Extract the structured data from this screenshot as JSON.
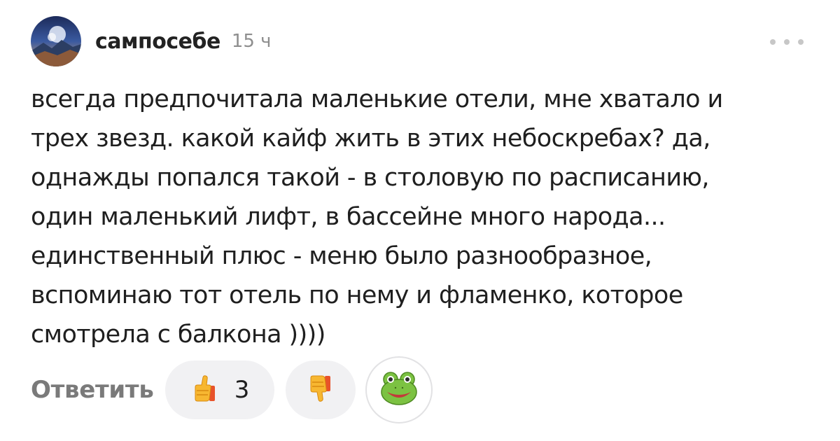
{
  "comment": {
    "author": "сампосебе",
    "time": "15 ч",
    "text_lines": [
      "всегда предпочитала маленькие отели, мне хватало и",
      "трех звезд. какой кайф жить в этих небоскребах? да,",
      "однажды попался такой - в столовую по расписанию,",
      "один маленький лифт, в бассейне много народа...",
      "единственный плюс - меню было разнообразное,",
      "вспоминаю тот отель по нему и фламенко, которое",
      "смотрела с балкона ))))"
    ]
  },
  "actions": {
    "reply_label": "Ответить",
    "like_count": "3"
  },
  "icons": {
    "more": "more-dots-icon",
    "like": "thumbs-up-icon",
    "dislike": "thumbs-down-icon",
    "reaction": "frog-emoji-icon"
  },
  "colors": {
    "text": "#1f1f1f",
    "muted": "#8e8e8e",
    "pill_bg": "#f1f1f3"
  }
}
